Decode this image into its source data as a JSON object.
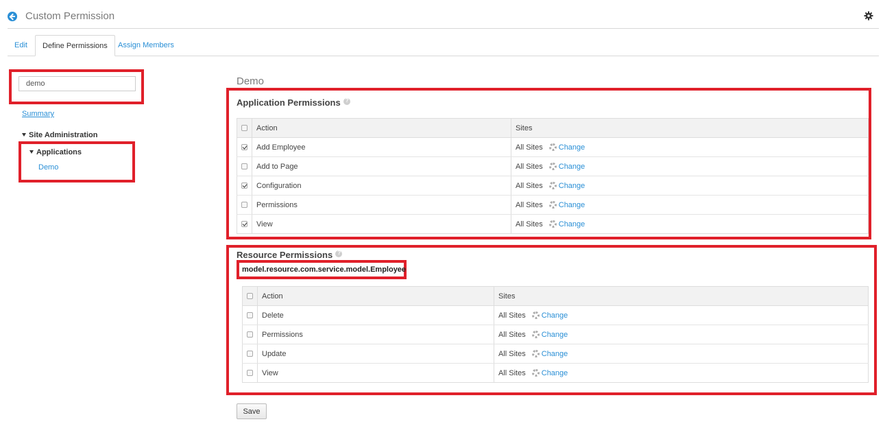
{
  "header": {
    "title": "Custom Permission"
  },
  "tabs": [
    {
      "label": "Edit"
    },
    {
      "label": "Define Permissions"
    },
    {
      "label": "Assign Members"
    }
  ],
  "sidebar": {
    "search": {
      "value": "demo"
    },
    "summary_label": "Summary",
    "tree": {
      "root_label": "Site Administration",
      "group_label": "Applications",
      "item_label": "Demo"
    }
  },
  "main": {
    "section_title": "Demo",
    "application_permissions": {
      "title": "Application Permissions",
      "columns": {
        "action": "Action",
        "sites": "Sites"
      },
      "rows": [
        {
          "action": "Add Employee",
          "checked": true,
          "sites": "All Sites",
          "change": "Change"
        },
        {
          "action": "Add to Page",
          "checked": false,
          "sites": "All Sites",
          "change": "Change"
        },
        {
          "action": "Configuration",
          "checked": true,
          "sites": "All Sites",
          "change": "Change"
        },
        {
          "action": "Permissions",
          "checked": false,
          "sites": "All Sites",
          "change": "Change"
        },
        {
          "action": "View",
          "checked": true,
          "sites": "All Sites",
          "change": "Change"
        }
      ]
    },
    "resource_permissions": {
      "title": "Resource Permissions",
      "resource_name": "model.resource.com.service.model.Employee",
      "columns": {
        "action": "Action",
        "sites": "Sites"
      },
      "rows": [
        {
          "action": "Delete",
          "checked": false,
          "sites": "All Sites",
          "change": "Change"
        },
        {
          "action": "Permissions",
          "checked": false,
          "sites": "All Sites",
          "change": "Change"
        },
        {
          "action": "Update",
          "checked": false,
          "sites": "All Sites",
          "change": "Change"
        },
        {
          "action": "View",
          "checked": false,
          "sites": "All Sites",
          "change": "Change"
        }
      ]
    },
    "save_label": "Save"
  },
  "colors": {
    "link": "#2a8fd6",
    "highlight": "#e0202a"
  }
}
